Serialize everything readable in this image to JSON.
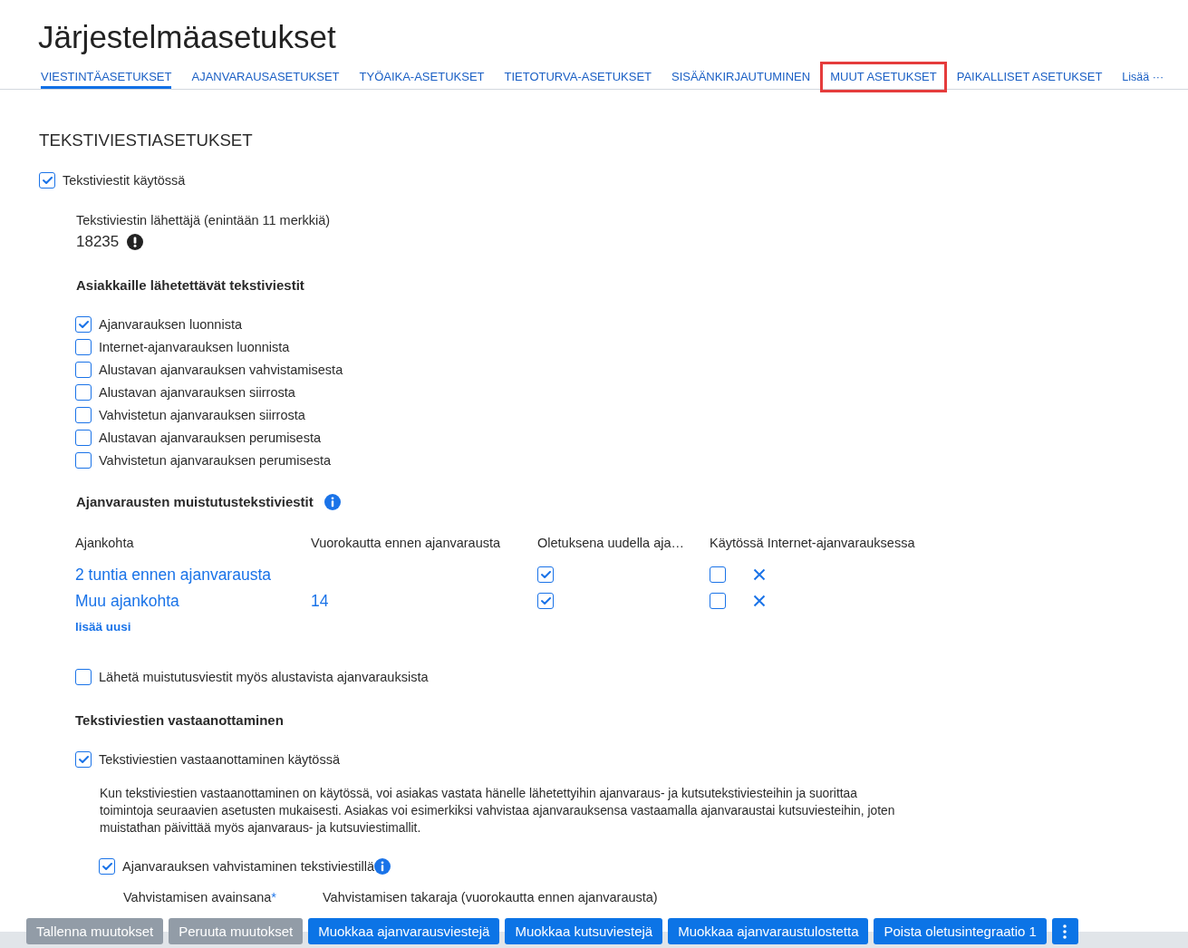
{
  "page": {
    "title": "Järjestelmäasetukset"
  },
  "tabs": [
    {
      "label": "VIESTINTÄASETUKSET",
      "selected": true,
      "highlighted": false
    },
    {
      "label": "AJANVARAUSASETUKSET",
      "selected": false,
      "highlighted": false
    },
    {
      "label": "TYÖAIKA-ASETUKSET",
      "selected": false,
      "highlighted": false
    },
    {
      "label": "TIETOTURVA-ASETUKSET",
      "selected": false,
      "highlighted": false
    },
    {
      "label": "SISÄÄNKIRJAUTUMINEN",
      "selected": false,
      "highlighted": false
    },
    {
      "label": "MUUT ASETUKSET",
      "selected": false,
      "highlighted": true
    },
    {
      "label": "PAIKALLISET ASETUKSET",
      "selected": false,
      "highlighted": false
    }
  ],
  "more_link": {
    "label": "Lisää ···"
  },
  "sms_settings": {
    "title": "TEKSTIVIESTIASETUKSET",
    "enabled": {
      "label": "Tekstiviestit käytössä",
      "checked": true
    },
    "sender": {
      "label": "Tekstiviestin lähettäjä (enintään 11 merkkiä)",
      "value": "18235"
    },
    "customer_messages": {
      "title": "Asiakkaille lähetettävät tekstiviestit",
      "options": [
        {
          "label": "Ajanvarauksen luonnista",
          "checked": true
        },
        {
          "label": "Internet-ajanvarauksen luonnista",
          "checked": false
        },
        {
          "label": "Alustavan ajanvarauksen vahvistamisesta",
          "checked": false
        },
        {
          "label": "Alustavan ajanvarauksen siirrosta",
          "checked": false
        },
        {
          "label": "Vahvistetun ajanvarauksen siirrosta",
          "checked": false
        },
        {
          "label": "Alustavan ajanvarauksen perumisesta",
          "checked": false
        },
        {
          "label": "Vahvistetun ajanvarauksen perumisesta",
          "checked": false
        }
      ]
    },
    "reminders": {
      "title": "Ajanvarausten muistutustekstiviestit",
      "columns": [
        "Ajankohta",
        "Vuorokautta ennen ajanvarausta",
        "Oletuksena uudella aja…",
        "Käytössä Internet-ajanvarauksessa"
      ],
      "rows": [
        {
          "time": "2 tuntia ennen ajanvarausta",
          "default_for_new": true,
          "internet": false
        },
        {
          "time": "Muu ajankohta",
          "days": "14",
          "default_for_new": true,
          "internet": false
        }
      ],
      "add_link": "lisää uusi"
    },
    "preliminary_reminders": {
      "label": "Lähetä muistutusviestit myös alustavista ajanvarauksista",
      "checked": false
    },
    "receiving": {
      "title": "Tekstiviestien vastaanottaminen",
      "enabled": {
        "label": "Tekstiviestien vastaanottaminen käytössä",
        "checked": true
      },
      "description": "Kun tekstiviestien vastaanottaminen on käytössä, voi asiakas vastata hänelle lähetettyihin ajanvaraus- ja kutsutekstiviesteihin ja suorittaa toimintoja seuraavien asetusten mukaisesti. Asiakas voi esimerkiksi vahvistaa ajanvarauksensa vastaamalla ajanvaraustai kutsuviesteihin, joten muistathan päivittää myös ajanvaraus- ja kutsuviestimallit.",
      "confirmation": {
        "label": "Ajanvarauksen vahvistaminen tekstiviestillä",
        "checked": true
      },
      "fields": [
        {
          "label": "Vahvistamisen avainsana",
          "required_mark": "*"
        },
        {
          "label": "Vahvistamisen takaraja (vuorokautta ennen ajanvarausta)"
        }
      ]
    }
  },
  "footer": {
    "buttons": [
      {
        "label": "Tallenna muutokset",
        "disabled": true
      },
      {
        "label": "Peruuta muutokset",
        "disabled": true
      },
      {
        "label": "Muokkaa ajanvarausviestejä",
        "disabled": false
      },
      {
        "label": "Muokkaa kutsuviestejä",
        "disabled": false
      },
      {
        "label": "Muokkaa ajanvaraustulostetta",
        "disabled": false
      },
      {
        "label": "Poista oletusintegraatio 1",
        "disabled": false
      }
    ]
  }
}
